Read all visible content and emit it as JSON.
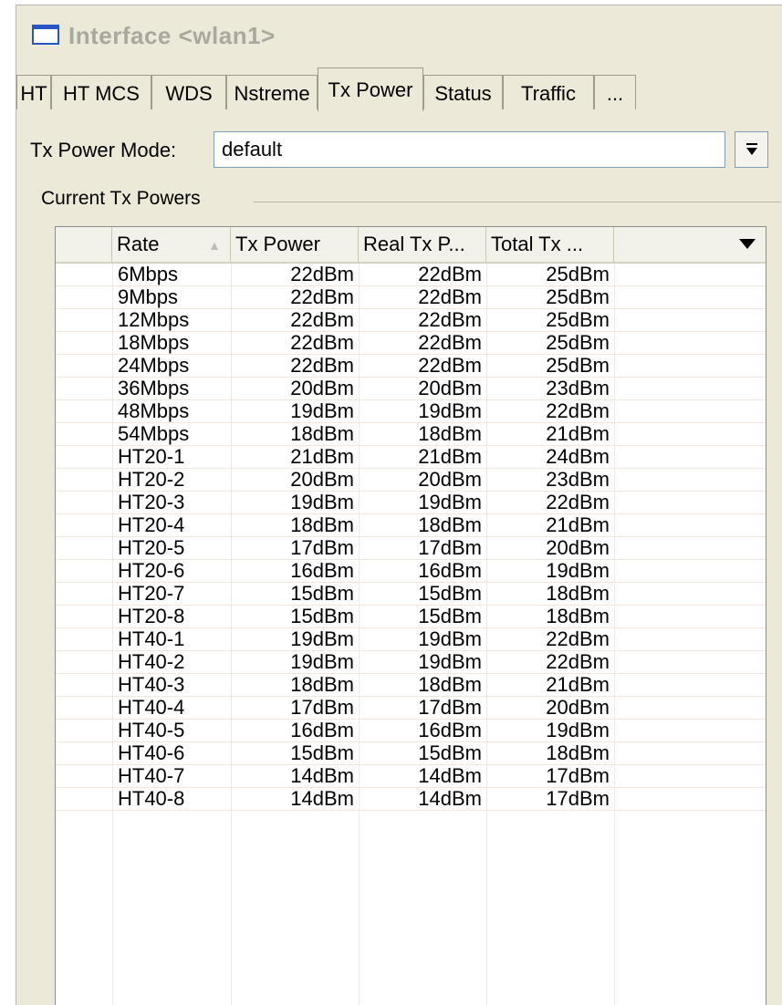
{
  "window": {
    "title": "Interface <wlan1>"
  },
  "tabs": [
    {
      "label": "HT"
    },
    {
      "label": "HT MCS"
    },
    {
      "label": "WDS"
    },
    {
      "label": "Nstreme"
    },
    {
      "label": "Tx Power"
    },
    {
      "label": "Status"
    },
    {
      "label": "Traffic"
    },
    {
      "label": "..."
    }
  ],
  "active_tab": "Tx Power",
  "tx_power_mode": {
    "label": "Tx Power Mode:",
    "value": "default"
  },
  "group": {
    "label": "Current Tx Powers"
  },
  "table": {
    "columns": [
      "",
      "Rate",
      "Tx Power",
      "Real Tx P...",
      "Total Tx ...",
      ""
    ],
    "sorted_by": "Rate",
    "rows": [
      [
        "6Mbps",
        "22dBm",
        "22dBm",
        "25dBm"
      ],
      [
        "9Mbps",
        "22dBm",
        "22dBm",
        "25dBm"
      ],
      [
        "12Mbps",
        "22dBm",
        "22dBm",
        "25dBm"
      ],
      [
        "18Mbps",
        "22dBm",
        "22dBm",
        "25dBm"
      ],
      [
        "24Mbps",
        "22dBm",
        "22dBm",
        "25dBm"
      ],
      [
        "36Mbps",
        "20dBm",
        "20dBm",
        "23dBm"
      ],
      [
        "48Mbps",
        "19dBm",
        "19dBm",
        "22dBm"
      ],
      [
        "54Mbps",
        "18dBm",
        "18dBm",
        "21dBm"
      ],
      [
        "HT20-1",
        "21dBm",
        "21dBm",
        "24dBm"
      ],
      [
        "HT20-2",
        "20dBm",
        "20dBm",
        "23dBm"
      ],
      [
        "HT20-3",
        "19dBm",
        "19dBm",
        "22dBm"
      ],
      [
        "HT20-4",
        "18dBm",
        "18dBm",
        "21dBm"
      ],
      [
        "HT20-5",
        "17dBm",
        "17dBm",
        "20dBm"
      ],
      [
        "HT20-6",
        "16dBm",
        "16dBm",
        "19dBm"
      ],
      [
        "HT20-7",
        "15dBm",
        "15dBm",
        "18dBm"
      ],
      [
        "HT20-8",
        "15dBm",
        "15dBm",
        "18dBm"
      ],
      [
        "HT40-1",
        "19dBm",
        "19dBm",
        "22dBm"
      ],
      [
        "HT40-2",
        "19dBm",
        "19dBm",
        "22dBm"
      ],
      [
        "HT40-3",
        "18dBm",
        "18dBm",
        "21dBm"
      ],
      [
        "HT40-4",
        "17dBm",
        "17dBm",
        "20dBm"
      ],
      [
        "HT40-5",
        "16dBm",
        "16dBm",
        "19dBm"
      ],
      [
        "HT40-6",
        "15dBm",
        "15dBm",
        "18dBm"
      ],
      [
        "HT40-7",
        "14dBm",
        "14dBm",
        "17dBm"
      ],
      [
        "HT40-8",
        "14dBm",
        "14dBm",
        "17dBm"
      ]
    ]
  }
}
